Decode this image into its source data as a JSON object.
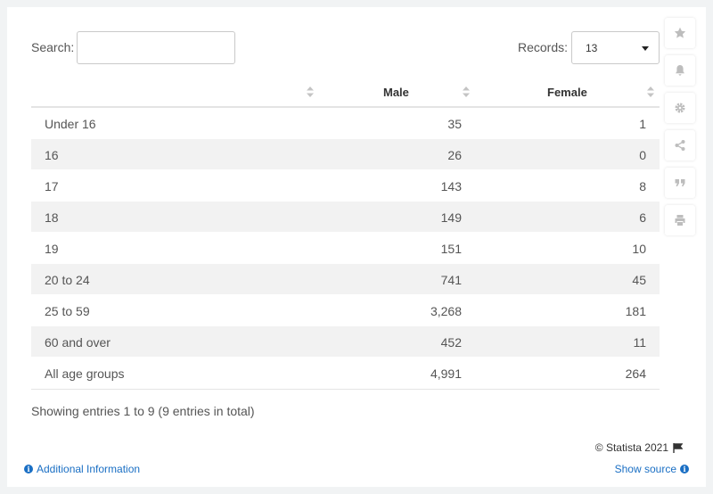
{
  "search": {
    "label": "Search:",
    "value": ""
  },
  "records": {
    "label": "Records:",
    "value": "13"
  },
  "sidebar": {
    "icons": [
      "star-icon",
      "bell-icon",
      "gear-icon",
      "share-icon",
      "quote-icon",
      "print-icon"
    ]
  },
  "table": {
    "headers": [
      "",
      "Male",
      "Female"
    ],
    "rows": [
      [
        "Under 16",
        "35",
        "1"
      ],
      [
        "16",
        "26",
        "0"
      ],
      [
        "17",
        "143",
        "8"
      ],
      [
        "18",
        "149",
        "6"
      ],
      [
        "19",
        "151",
        "10"
      ],
      [
        "20 to 24",
        "741",
        "45"
      ],
      [
        "25 to 59",
        "3,268",
        "181"
      ],
      [
        "60 and over",
        "452",
        "11"
      ],
      [
        "All age groups",
        "4,991",
        "264"
      ]
    ]
  },
  "summary": "Showing entries 1 to 9 (9 entries in total)",
  "footer": {
    "copyright": "© Statista 2021",
    "additional_info": "Additional Information",
    "show_source": "Show source"
  },
  "colors": {
    "link": "#1a6fc4",
    "stripe": "#f2f2f2",
    "icon": "#bdbdbd"
  }
}
